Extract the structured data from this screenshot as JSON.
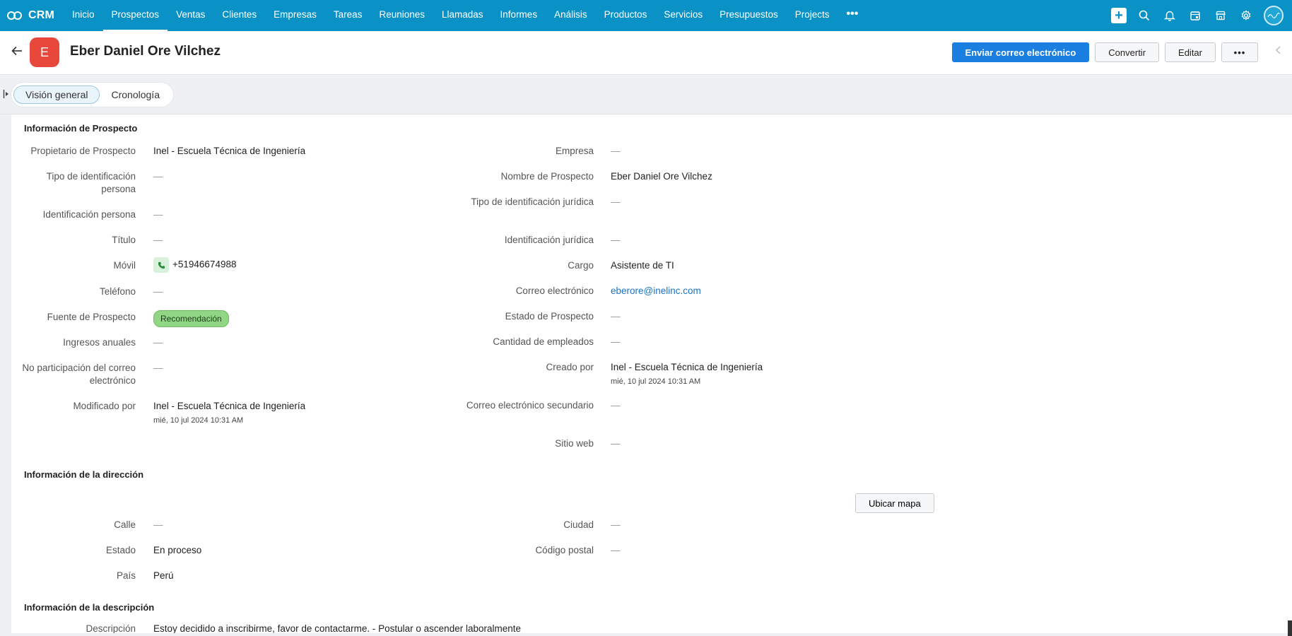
{
  "nav": {
    "brand": "CRM",
    "items": [
      {
        "label": "Inicio",
        "active": false
      },
      {
        "label": "Prospectos",
        "active": true
      },
      {
        "label": "Ventas",
        "active": false
      },
      {
        "label": "Clientes",
        "active": false
      },
      {
        "label": "Empresas",
        "active": false
      },
      {
        "label": "Tareas",
        "active": false
      },
      {
        "label": "Reuniones",
        "active": false
      },
      {
        "label": "Llamadas",
        "active": false
      },
      {
        "label": "Informes",
        "active": false
      },
      {
        "label": "Análisis",
        "active": false
      },
      {
        "label": "Productos",
        "active": false
      },
      {
        "label": "Servicios",
        "active": false
      },
      {
        "label": "Presupuestos",
        "active": false
      },
      {
        "label": "Projects",
        "active": false
      }
    ],
    "more": "•••",
    "icons": [
      "plus-icon",
      "search-icon",
      "bell-icon",
      "calendar-icon",
      "marketplace-icon",
      "gear-icon",
      "user-avatar"
    ],
    "accent": "#0a92c6"
  },
  "header": {
    "avatar_letter": "E",
    "title": "Eber Daniel Ore Vilchez",
    "send_email": "Enviar correo electrónico",
    "convert": "Convertir",
    "edit": "Editar",
    "more": "•••"
  },
  "tabs": {
    "overview": "Visión general",
    "timeline": "Cronología"
  },
  "prospect": {
    "title": "Información de Prospecto",
    "left": [
      {
        "label": "Propietario de Prospecto",
        "value": "Inel - Escuela Técnica de Ingeniería"
      },
      {
        "label": "Tipo de identificación persona",
        "value": "—"
      },
      {
        "label": "Identificación persona",
        "value": "—"
      },
      {
        "label": "Título",
        "value": "—"
      },
      {
        "label": "Móvil",
        "value": "+51946674988"
      },
      {
        "label": "Teléfono",
        "value": "—"
      },
      {
        "label": "Fuente de Prospecto",
        "value": "Recomendación"
      },
      {
        "label": "Ingresos anuales",
        "value": "—"
      },
      {
        "label": "No participación del correo electrónico",
        "value": "—"
      },
      {
        "label": "Modificado por",
        "value": "Inel - Escuela Técnica de Ingeniería",
        "sub": "mié, 10 jul 2024 10:31 AM"
      }
    ],
    "right": [
      {
        "label": "Empresa",
        "value": "—"
      },
      {
        "label": "Nombre de Prospecto",
        "value": "Eber Daniel Ore Vilchez"
      },
      {
        "label": "Tipo de identificación jurídica",
        "value": "—"
      },
      {
        "label": "Identificación jurídica",
        "value": "—"
      },
      {
        "label": "Cargo",
        "value": "Asistente de TI"
      },
      {
        "label": "Correo electrónico",
        "value": "eberore@inelinc.com"
      },
      {
        "label": "Estado de Prospecto",
        "value": "—"
      },
      {
        "label": "Cantidad de empleados",
        "value": "—"
      },
      {
        "label": "Creado por",
        "value": "Inel - Escuela Técnica de Ingeniería",
        "sub": "mié, 10 jul 2024 10:31 AM"
      },
      {
        "label": "Correo electrónico secundario",
        "value": "—"
      },
      {
        "label": "Sitio web",
        "value": "—"
      }
    ]
  },
  "address": {
    "title": "Información de la dirección",
    "map_button": "Ubicar mapa",
    "left": [
      {
        "label": "Calle",
        "value": "—"
      },
      {
        "label": "Estado",
        "value": "En proceso"
      },
      {
        "label": "País",
        "value": "Perú"
      }
    ],
    "right": [
      {
        "label": "Ciudad",
        "value": "—"
      },
      {
        "label": "Código postal",
        "value": "—"
      }
    ]
  },
  "description": {
    "title": "Información de la descripción",
    "label": "Descripción",
    "value": "Estoy decidido a inscribirme, favor de contactarme. - Postular o ascender laboralmente"
  }
}
